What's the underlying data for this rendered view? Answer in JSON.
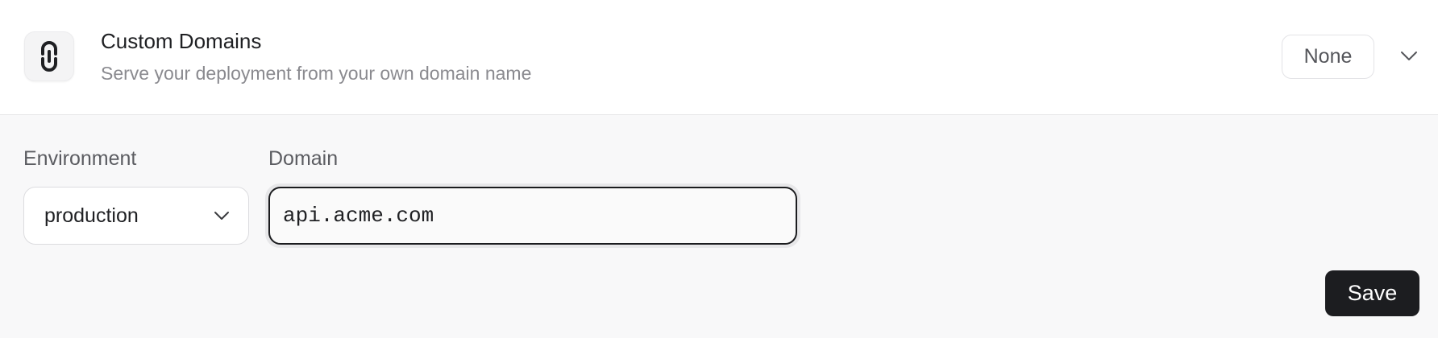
{
  "header": {
    "icon": "link-icon",
    "title": "Custom Domains",
    "subtitle": "Serve your deployment from your own domain name",
    "status_badge": "None",
    "toggle_icon": "chevron-down-icon"
  },
  "form": {
    "environment": {
      "label": "Environment",
      "selected": "production",
      "icon": "chevron-down-icon"
    },
    "domain": {
      "label": "Domain",
      "value": "api.acme.com"
    },
    "save_label": "Save"
  },
  "colors": {
    "primary_button": "#1c1d20",
    "panel_background": "#f8f8f9",
    "muted_text": "#8a8a8f"
  }
}
